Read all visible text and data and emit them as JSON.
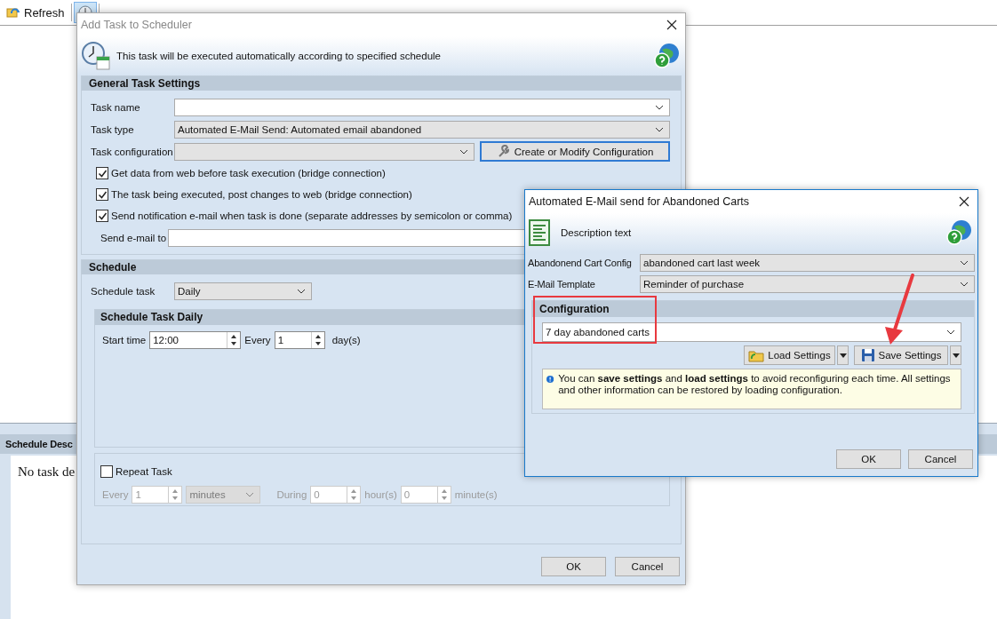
{
  "toolbar": {
    "items": [
      {
        "kind": "refresh",
        "label": "Refresh",
        "selected": false
      },
      {
        "kind": "add-task",
        "selected": true
      }
    ]
  },
  "background_panel": {
    "title": "Schedule Desc",
    "text": "No task de"
  },
  "dialog": {
    "title": "Add Task to Scheduler",
    "active": false,
    "header_text": "This task will be executed automatically according to specified schedule",
    "general_title": "General Task Settings",
    "fields": [
      {
        "label": "Task name",
        "kind": "editable"
      },
      {
        "label": "Task type",
        "value": "Automated E-Mail Send: Automated email abandoned",
        "kind": "readonly"
      },
      {
        "label": "Task configuration",
        "kind": "readonly"
      }
    ],
    "config_button": "Create or Modify Configuration",
    "checkboxes": [
      {
        "label": "Get data from web before task execution (bridge connection)",
        "checked": true
      },
      {
        "label": "The task being executed, post changes to web (bridge connection)",
        "checked": true
      },
      {
        "label": "Send notification e-mail when task is done (separate addresses by semicolon or comma)",
        "checked": true
      }
    ],
    "email_label": "Send e-mail to",
    "schedule_title": "Schedule",
    "schedule_task_label": "Schedule task",
    "schedule_task_value": "Daily",
    "daily_title": "Schedule Task Daily",
    "start_time_label": "Start time",
    "start_time": "12:00",
    "every_label": "Every",
    "every_value": "1",
    "days_label": "day(s)",
    "repeat": {
      "label": "Repeat Task",
      "checked": false,
      "every_label": "Every",
      "every_value": "1",
      "unit": "minutes",
      "during_label": "During",
      "hours_value": "0",
      "hours_label": "hour(s)",
      "minutes_value": "0",
      "minutes_label": "minute(s)"
    },
    "buttons": [
      "OK",
      "Cancel"
    ]
  },
  "subdialog": {
    "title": "Automated E-Mail send for Abandoned Carts",
    "active": true,
    "header_text": "Description text",
    "fields": [
      {
        "label": "Abandonend Cart Config",
        "value": "abandoned cart last week"
      },
      {
        "label": "E-Mail Template",
        "value": "Reminder of purchase"
      }
    ],
    "config_title": "Configuration",
    "config_value": "7 day abandoned carts",
    "load_button": "Load Settings",
    "save_button": "Save Settings",
    "info": "You can **save settings** and **load settings** to avoid reconfiguring each time. All settings and other information can be restored by loading configuration.",
    "buttons": [
      "OK",
      "Cancel"
    ]
  }
}
